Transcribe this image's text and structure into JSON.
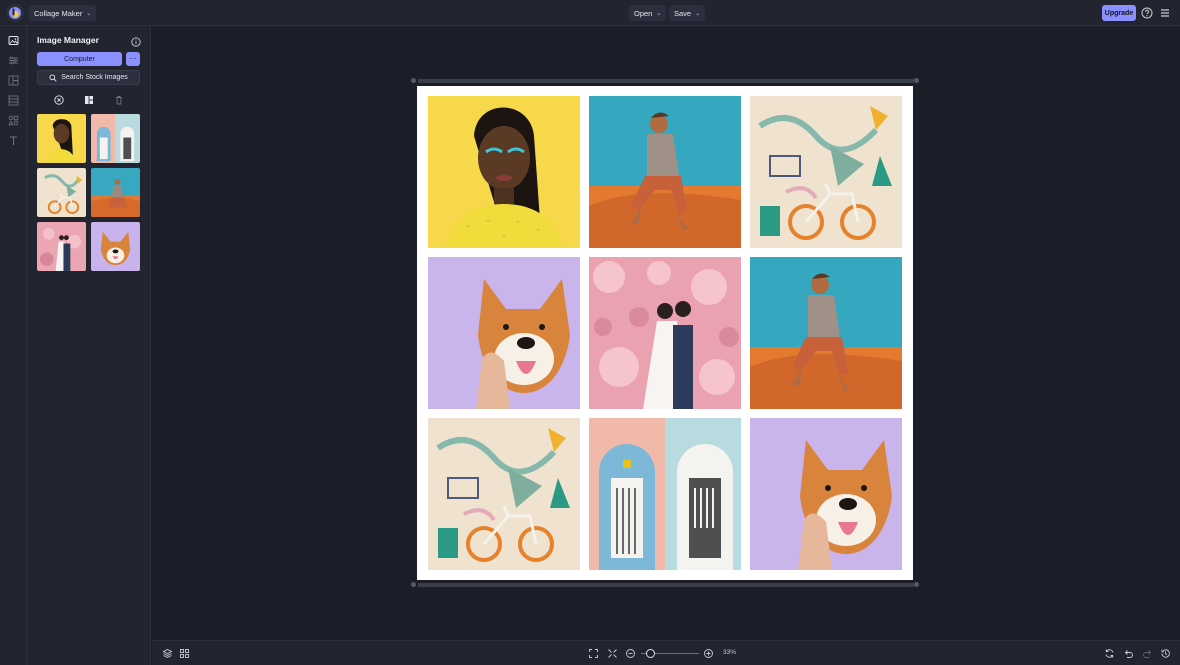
{
  "topbar": {
    "app_menu_label": "Collage Maker",
    "open_label": "Open",
    "save_label": "Save",
    "upgrade_label": "Upgrade",
    "icons": [
      "logo-icon",
      "help-icon",
      "menu-icon"
    ]
  },
  "rail": {
    "items": [
      "image-icon",
      "sliders-icon",
      "layout-icon",
      "background-icon",
      "graphics-icon",
      "text-icon"
    ]
  },
  "image_manager": {
    "title": "Image Manager",
    "computer_label": "Computer",
    "more_label": "···",
    "stock_label": "Search Stock Images",
    "thumbnails": [
      "portrait-woman",
      "pastel-doors",
      "mural-bicycle",
      "man-desert",
      "wedding-couple",
      "shiba-dog"
    ]
  },
  "collage": {
    "cells": [
      "portrait-woman",
      "man-desert",
      "mural-bicycle",
      "shiba-dog",
      "wedding-couple",
      "man-desert",
      "mural-bicycle",
      "pastel-doors",
      "shiba-dog"
    ]
  },
  "bottombar": {
    "zoom_label": "33%"
  },
  "colors": {
    "accent": "#8a90ff",
    "background": "#1b1d28",
    "panel": "#22242f"
  }
}
